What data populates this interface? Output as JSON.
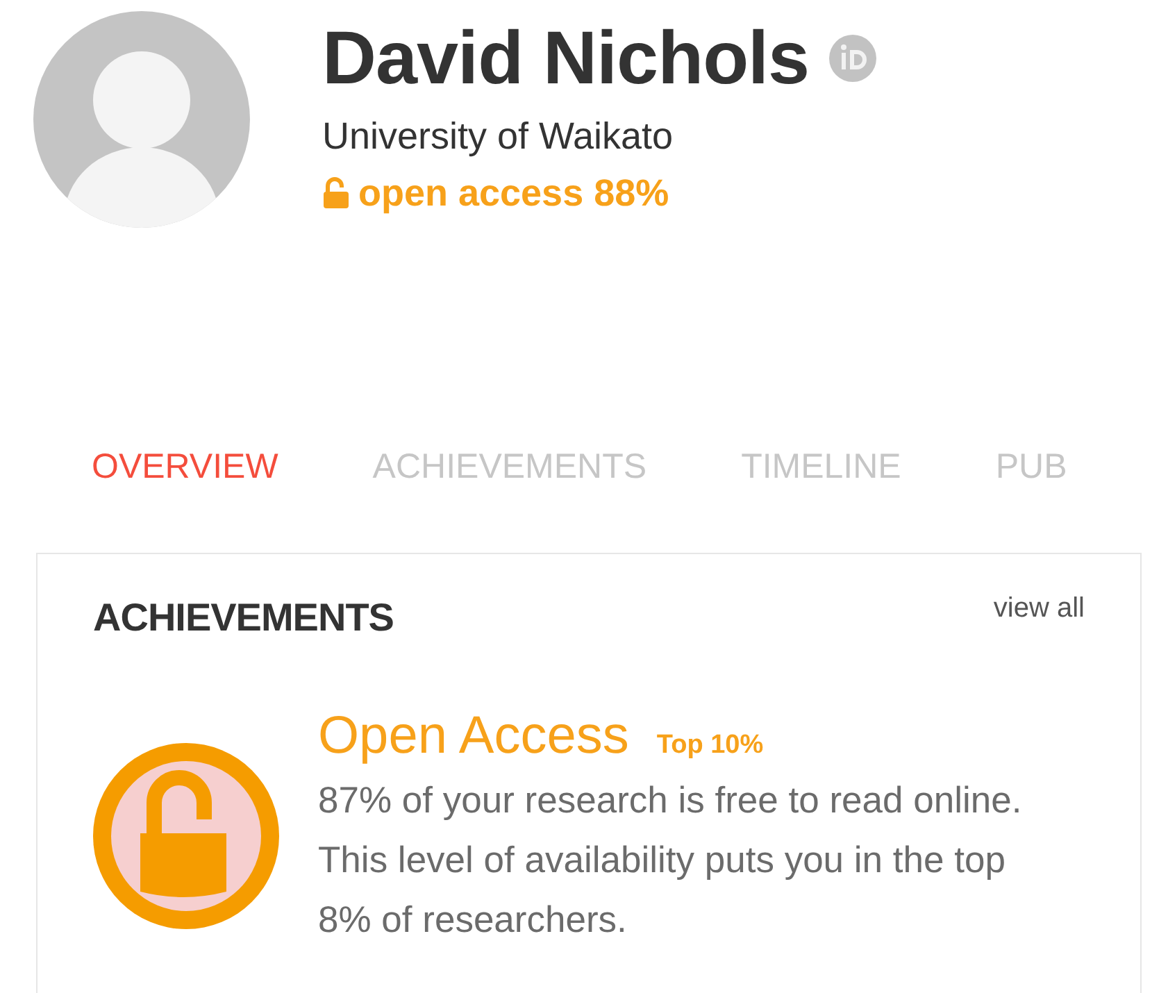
{
  "profile": {
    "name": "David Nichols",
    "affiliation": "University of Waikato",
    "open_access": "open access 88%"
  },
  "tabs": [
    {
      "label": "OVERVIEW",
      "selected": true
    },
    {
      "label": "ACHIEVEMENTS",
      "selected": false
    },
    {
      "label": "TIMELINE",
      "selected": false
    },
    {
      "label": "PUB",
      "selected": false
    }
  ],
  "achievements": {
    "title": "ACHIEVEMENTS",
    "view_all": "view all",
    "items": [
      {
        "title": "Open Access",
        "rank": "Top 10%",
        "description": "87% of your research is free to read online. This level of availability puts you in the top 8% of researchers."
      }
    ]
  }
}
